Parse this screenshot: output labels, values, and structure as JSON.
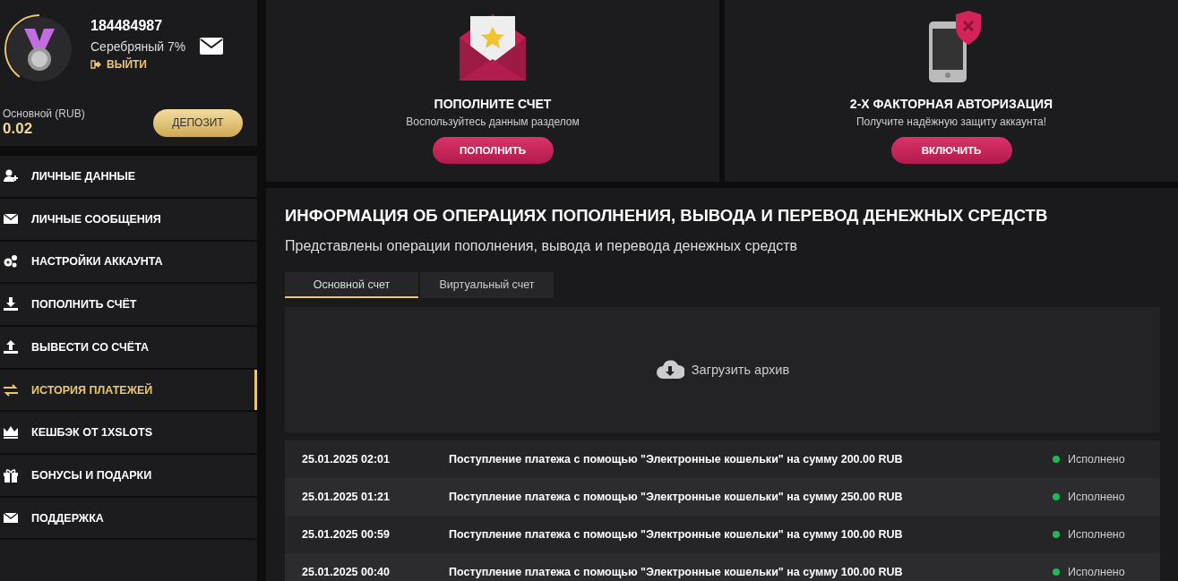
{
  "profile": {
    "account_id": "184484987",
    "status": "Серебряный 7%",
    "logout": "ВЫЙТИ",
    "balance_label": "Основной (RUB)",
    "balance": "0.02",
    "deposit_button": "ДЕПОЗИТ"
  },
  "sidebar": {
    "items": [
      {
        "label": "ЛИЧНЫЕ ДАННЫЕ",
        "selected": false
      },
      {
        "label": "ЛИЧНЫЕ СООБЩЕНИЯ",
        "selected": false
      },
      {
        "label": "НАСТРОЙКИ АККАУНТА",
        "selected": false
      },
      {
        "label": "ПОПОЛНИТЬ СЧЁТ",
        "selected": false
      },
      {
        "label": "ВЫВЕСТИ СО СЧЁТА",
        "selected": false
      },
      {
        "label": "ИСТОРИЯ ПЛАТЕЖЕЙ",
        "selected": true
      },
      {
        "label": "КЕШБЭК ОТ 1XSLOTS",
        "selected": false
      },
      {
        "label": "БОНУСЫ И ПОДАРКИ",
        "selected": false
      },
      {
        "label": "ПОДДЕРЖКА",
        "selected": false
      }
    ]
  },
  "promo_cards": [
    {
      "kind": "deposit",
      "title": "ПОПОЛНИТЕ СЧЕТ",
      "subtitle": "Воспользуйтесь данным разделом",
      "button": "ПОПОЛНИТЬ"
    },
    {
      "kind": "twofactor",
      "title": "2-Х ФАКТОРНАЯ АВТОРИЗАЦИЯ",
      "subtitle": "Получите надёжную защиту аккаунта!",
      "button": "ВКЛЮЧИТЬ"
    }
  ],
  "history": {
    "title": "ИНФОРМАЦИЯ ОБ ОПЕРАЦИЯХ ПОПОЛНЕНИЯ, ВЫВОДА И ПЕРЕВОД ДЕНЕЖНЫХ СРЕДСТВ",
    "subtitle": "Представлены операции пополнения, вывода и перевода денежных средств",
    "tabs": [
      {
        "label": "Основной счет",
        "selected": true
      },
      {
        "label": "Виртуальный счет",
        "selected": false
      }
    ],
    "archive_button": "Загрузить архив",
    "rows": [
      {
        "date": "25.01.2025 02:01",
        "description": "Поступление платежа с помощью \"Электронные кошельки\" на сумму 200.00 RUB",
        "status": "Исполнено",
        "color": "#1db954"
      },
      {
        "date": "25.01.2025 01:21",
        "description": "Поступление платежа с помощью \"Электронные кошельки\" на сумму 250.00 RUB",
        "status": "Исполнено",
        "color": "#1db954"
      },
      {
        "date": "25.01.2025 00:59",
        "description": "Поступление платежа с помощью \"Электронные кошельки\" на сумму 100.00 RUB",
        "status": "Исполнено",
        "color": "#1db954"
      },
      {
        "date": "25.01.2025 00:40",
        "description": "Поступление платежа с помощью \"Электронные кошельки\" на сумму 100.00 RUB",
        "status": "Исполнено",
        "color": "#1db954"
      }
    ]
  }
}
